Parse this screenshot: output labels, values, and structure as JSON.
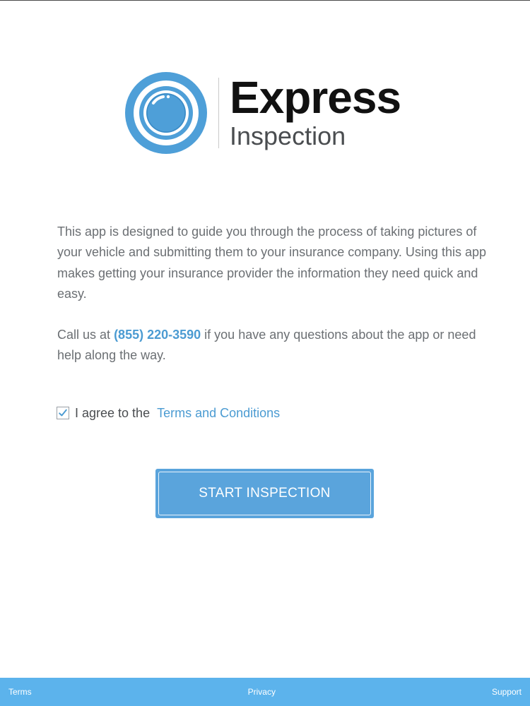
{
  "brand": {
    "title": "Express",
    "subtitle": "Inspection",
    "colors": {
      "accent": "#5aa4dc",
      "link": "#4b9bd2",
      "footer": "#5cb3ec"
    },
    "icon": "camera-lens-icon"
  },
  "intro": {
    "paragraph": "This app is designed to guide you through the process of taking pictures of your vehicle and submitting them to your insurance company. Using this app makes getting your insurance provider the information they need quick and easy."
  },
  "contact": {
    "prefix": "Call us at",
    "phone": "(855) 220-3590",
    "suffix": "if you have any questions about the app or need help along the way."
  },
  "agreement": {
    "checked": true,
    "label": "I agree to the",
    "link_text": "Terms and Conditions",
    "check_icon": "checkmark-icon"
  },
  "start_button": {
    "label": "START INSPECTION"
  },
  "footer": {
    "terms": "Terms",
    "privacy": "Privacy",
    "support": "Support"
  }
}
